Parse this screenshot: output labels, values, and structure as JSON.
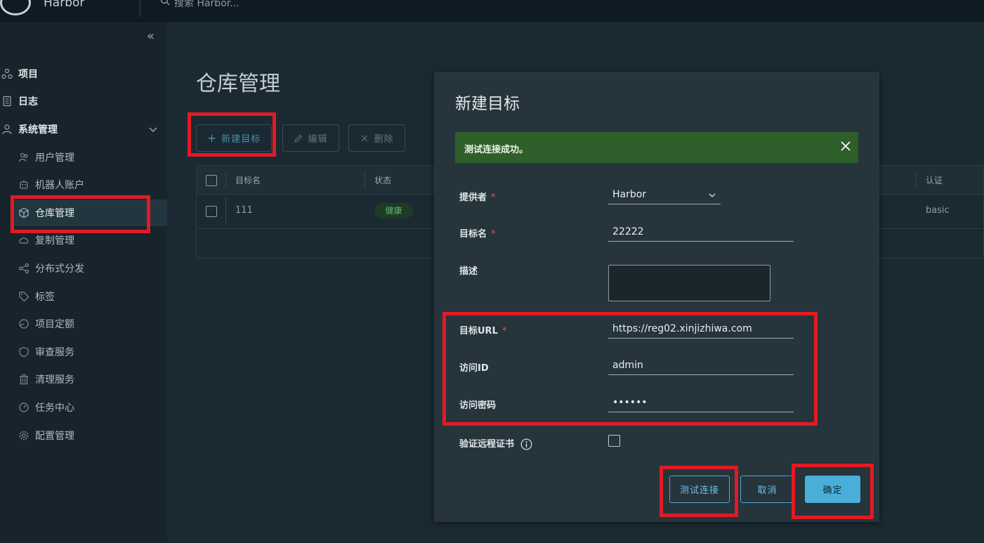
{
  "header": {
    "brand": "Harbor",
    "search_placeholder": "搜索 Harbor..."
  },
  "sidebar": {
    "items": [
      {
        "label": "项目",
        "icon": "project-icon"
      },
      {
        "label": "日志",
        "icon": "log-icon"
      },
      {
        "label": "系统管理",
        "icon": "admin-icon"
      }
    ],
    "sub_items": [
      {
        "label": "用户管理",
        "icon": "users-icon"
      },
      {
        "label": "机器人账户",
        "icon": "robot-icon"
      },
      {
        "label": "仓库管理",
        "icon": "registry-icon",
        "active": true
      },
      {
        "label": "复制管理",
        "icon": "replication-icon"
      },
      {
        "label": "分布式分发",
        "icon": "share-icon"
      },
      {
        "label": "标签",
        "icon": "tag-icon"
      },
      {
        "label": "项目定额",
        "icon": "quota-icon"
      },
      {
        "label": "审查服务",
        "icon": "shield-icon"
      },
      {
        "label": "清理服务",
        "icon": "trash-icon"
      },
      {
        "label": "任务中心",
        "icon": "dashboard-icon"
      },
      {
        "label": "配置管理",
        "icon": "gear-icon"
      }
    ]
  },
  "main": {
    "title": "仓库管理",
    "toolbar": {
      "new": "新建目标",
      "edit": "编辑",
      "delete": "删除"
    },
    "grid": {
      "columns": [
        "目标名",
        "状态",
        "认证"
      ],
      "rows": [
        {
          "name": "111",
          "status": "健康",
          "auth": "basic"
        }
      ]
    }
  },
  "modal": {
    "title": "新建目标",
    "alert": "测试连接成功。",
    "fields": {
      "provider_label": "提供者",
      "provider_value": "Harbor",
      "name_label": "目标名",
      "name_value": "22222",
      "desc_label": "描述",
      "url_label": "目标URL",
      "url_value": "https://reg02.xinjizhiwa.com",
      "access_id_label": "访问ID",
      "access_id_value": "admin",
      "secret_label": "访问密码",
      "secret_value": "••••••",
      "verify_cert_label": "验证远程证书"
    },
    "required_mark": "*",
    "buttons": {
      "test": "测试连接",
      "cancel": "取消",
      "ok": "确定"
    }
  },
  "colors": {
    "accent": "#49afd9",
    "success": "#2e5e2a",
    "annotation": "#e21a25"
  }
}
